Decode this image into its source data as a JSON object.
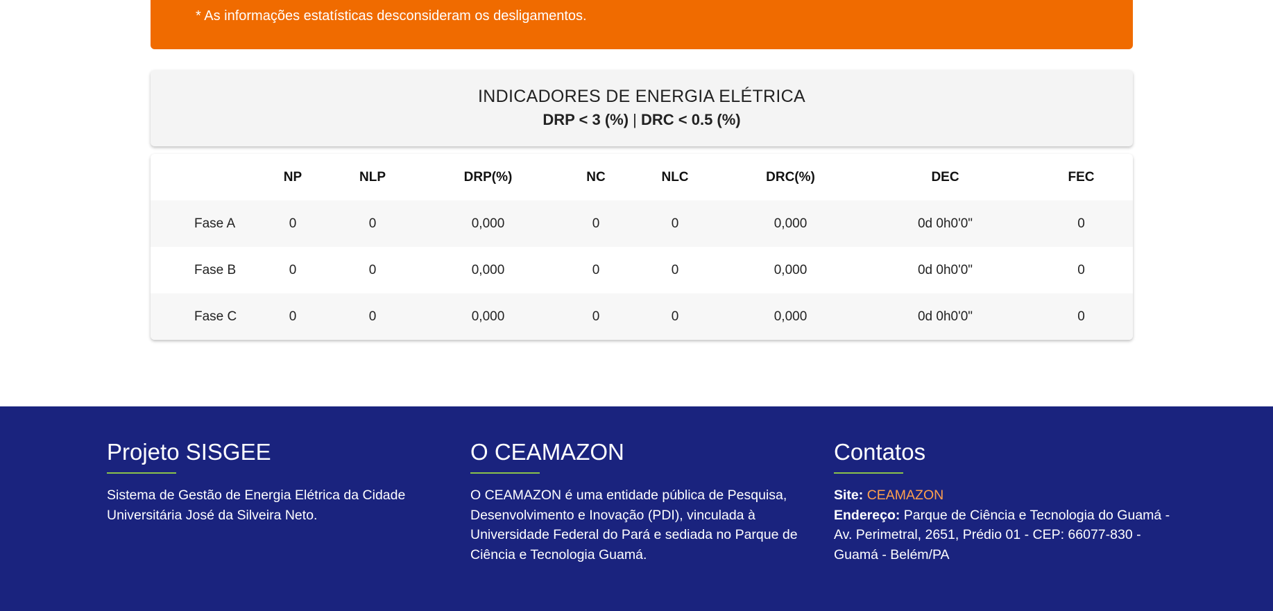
{
  "banner": {
    "note": "* As informações estatísticas desconsideram os desligamentos."
  },
  "indicators": {
    "title": "INDICADORES DE ENERGIA ELÉTRICA",
    "drp_limit": "DRP < 3 (%)",
    "separator": " | ",
    "drc_limit": "DRC < 0.5 (%)"
  },
  "table": {
    "headers": [
      "",
      "NP",
      "NLP",
      "DRP(%)",
      "NC",
      "NLC",
      "DRC(%)",
      "DEC",
      "FEC"
    ],
    "rows": [
      [
        "Fase A",
        "0",
        "0",
        "0,000",
        "0",
        "0",
        "0,000",
        "0d 0h0'0\"",
        "0"
      ],
      [
        "Fase B",
        "0",
        "0",
        "0,000",
        "0",
        "0",
        "0,000",
        "0d 0h0'0\"",
        "0"
      ],
      [
        "Fase C",
        "0",
        "0",
        "0,000",
        "0",
        "0",
        "0,000",
        "0d 0h0'0\"",
        "0"
      ]
    ]
  },
  "footer": {
    "project": {
      "title": "Projeto SISGEE",
      "text": "Sistema de Gestão de Energia Elétrica da Cidade Universitária José da Silveira Neto."
    },
    "ceamazon": {
      "title": "O CEAMAZON",
      "text": "O CEAMAZON é uma entidade pública de Pesquisa, Desenvolvimento e Inovação (PDI), vinculada à Universidade Federal do Pará e sediada no Parque de Ciência e Tecnologia Guamá."
    },
    "contacts": {
      "title": "Contatos",
      "site_label": "Site:",
      "site_link": "CEAMAZON",
      "address_label": "Endereço:",
      "address": "Parque de Ciência e Tecnologia do Guamá - Av. Perimetral, 2651, Prédio 01 - CEP: 66077-830 - Guamá - Belém/PA"
    }
  },
  "colors": {
    "banner": "#f06b00",
    "footer": "#1a237e",
    "accent_underline": "#8bc34a",
    "link": "#ffa04d"
  }
}
